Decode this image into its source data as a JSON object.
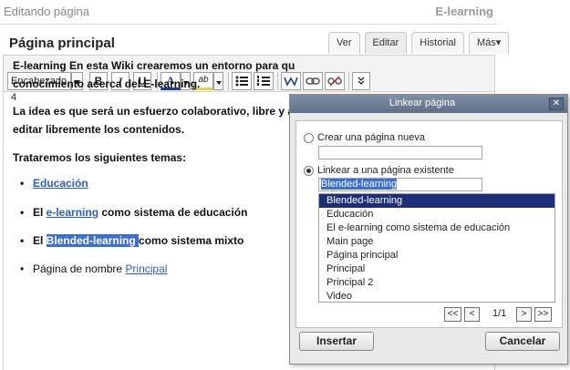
{
  "header": {
    "context_label": "Editando página",
    "site_name": "E-learning",
    "page_title": "Página principal"
  },
  "tabs": [
    {
      "label": "Ver"
    },
    {
      "label": "Editar"
    },
    {
      "label": "Historial"
    },
    {
      "label": "Más▾"
    }
  ],
  "toolbar": {
    "format_select": "Encabezado 4",
    "bold": "B",
    "italic": "I",
    "underline": "U",
    "font_color": "A",
    "highlight": "ab"
  },
  "content": {
    "p1_line1": "E-learning En esta Wiki crearemos un entorno para qu",
    "p1_line2": "conocimiento acerca del E-learning.",
    "p2_line1": "La idea es que será un esfuerzo colaborativo, libre y a",
    "p2_line2": "editar libremente los contenidos.",
    "p3": "Trataremos los siguientes temas:",
    "b1_link": "Educación",
    "b2_pre": "El ",
    "b2_link": "e-learning",
    "b2_post": " como sistema de educación",
    "b3_pre": "El ",
    "b3_sel": "Blended-learning ",
    "b3_post": "como sistema mixto",
    "b4_pre": "Página de nombre ",
    "b4_link": "Principal"
  },
  "dialog": {
    "title": "Linkear página",
    "close_glyph": "✕",
    "option_new": "Crear una página nueva",
    "option_existing": "Linkear a una página existente",
    "existing_value": "Blended-learning",
    "pages": [
      "Blended-learning",
      "Educación",
      "El e-learning como sistema de educación",
      "Main page",
      "Página principal",
      "Principal",
      "Principal 2",
      "Video"
    ],
    "page_indicator": "1/1",
    "first": "<<",
    "prev": "<",
    "next": ">",
    "last": ">>",
    "insert_label": "Insertar",
    "cancel_label": "Cancelar"
  },
  "colors": {
    "link": "#2b5dc4",
    "selection": "#3b6fd6",
    "list_selected": "#1e2f78",
    "dialog_title": "#6f7f96"
  }
}
